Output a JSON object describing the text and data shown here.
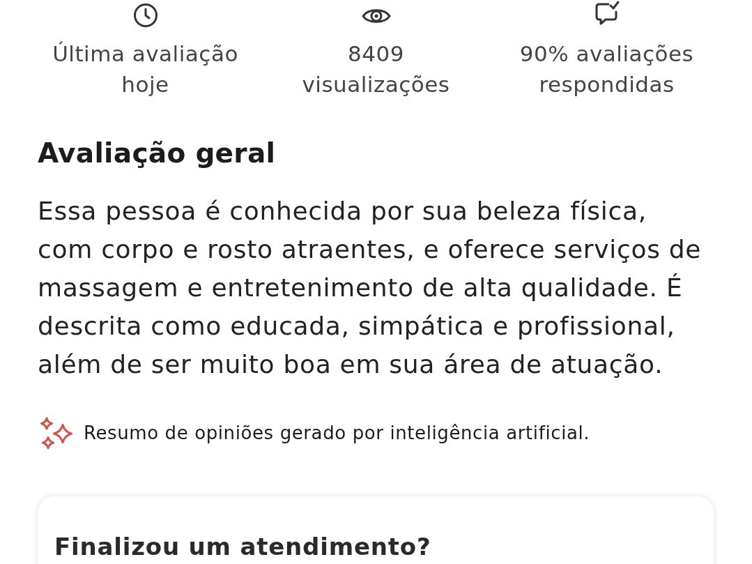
{
  "stats": [
    {
      "kind": "time",
      "text": "Última avaliação\nhoje"
    },
    {
      "kind": "views",
      "text": "8409\nvisualizações"
    },
    {
      "kind": "replies",
      "text": "90% avaliações\nrespondidas"
    }
  ],
  "overview": {
    "title": "Avaliação geral",
    "summary": "Essa pessoa é conhecida por sua beleza física, com corpo e rosto atraentes, e oferece serviços de massagem e entretenimento de alta qualidade. É descrita como educada, simpática e profissional, além de ser muito boa em sua área de atuação.",
    "ai_note": "Resumo de opiniões gerado por inteligência artificial."
  },
  "card": {
    "title": "Finalizou um atendimento?"
  }
}
